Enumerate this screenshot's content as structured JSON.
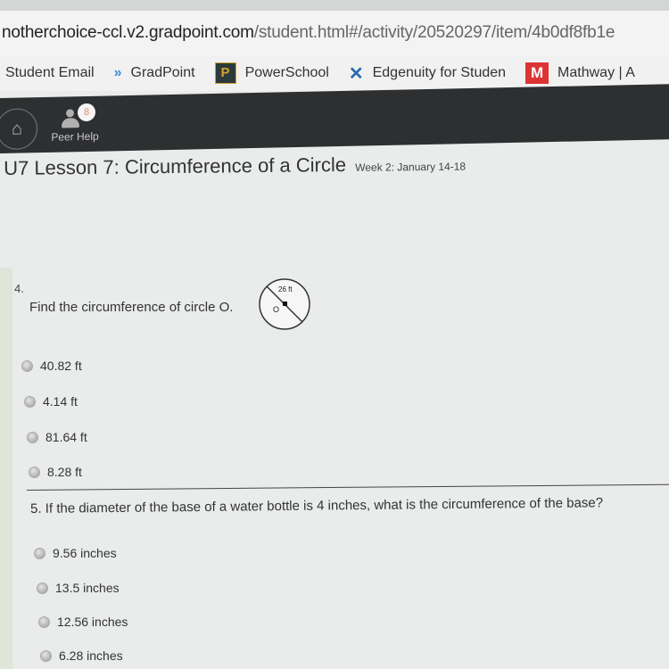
{
  "browser": {
    "url_host": "notherchoice-ccl.v2.gradpoint.com",
    "url_path": "/student.html#/activity/20520297/item/4b0df8fb1e",
    "bookmarks": [
      {
        "label": "Student Email",
        "icon": "none"
      },
      {
        "label": "GradPoint",
        "icon": "gradpoint-chevron-icon"
      },
      {
        "label": "PowerSchool",
        "icon": "powerschool-p-icon"
      },
      {
        "label": "Edgenuity for Studen",
        "icon": "edgenuity-x-icon"
      },
      {
        "label": "Mathway | A",
        "icon": "mathway-m-icon"
      }
    ]
  },
  "navbar": {
    "home_icon": "home-icon",
    "peer_help_label": "Peer Help",
    "peer_help_badge": "8"
  },
  "lesson": {
    "title": "U7 Lesson 7: Circumference of a Circle",
    "week": "Week 2: January 14-18"
  },
  "question4": {
    "number": "4.",
    "text": "Find the circumference of circle O.",
    "diagram_label": "26 ft",
    "center_label": "O",
    "options": [
      "40.82 ft",
      "4.14 ft",
      "81.64 ft",
      "8.28 ft"
    ]
  },
  "question5": {
    "text": "5. If the diameter of the base of a water bottle is 4 inches, what is the circumference of the base?",
    "options": [
      "9.56 inches",
      "13.5 inches",
      "12.56 inches",
      "6.28 inches"
    ]
  }
}
